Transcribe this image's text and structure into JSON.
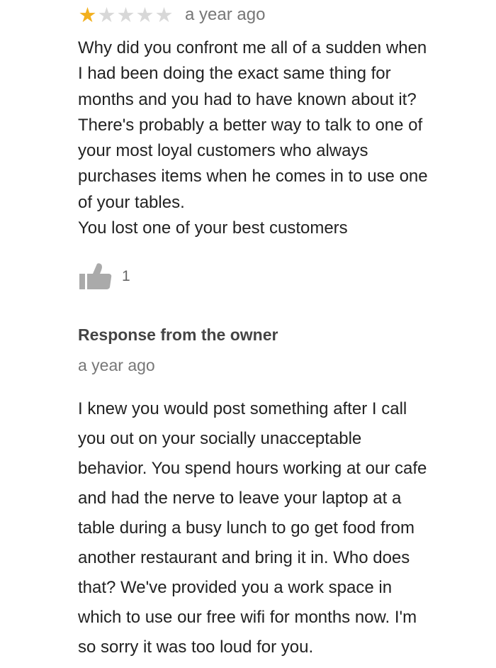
{
  "review": {
    "rating": 1,
    "rating_max": 5,
    "star_colors": {
      "filled": "#f2b01e",
      "empty": "#d8d8d8"
    },
    "timestamp": "a year ago",
    "text_lines": [
      "Why did you confront me all of a sudden when",
      "I had been doing the exact same thing for",
      "months and you had to have known about it?",
      "There's probably a better way to talk to one of",
      "your most loyal customers who always",
      "purchases items when he comes in to use one",
      "of your tables.",
      "You lost one of your best customers"
    ],
    "like_icon": "thumbs-up-icon",
    "like_count": "1"
  },
  "owner_response": {
    "heading": "Response from the owner",
    "timestamp": "a year ago",
    "text_lines": [
      "I knew you would post something after I call",
      "you out on your socially unacceptable",
      "behavior. You spend hours working at our cafe",
      "and had the nerve to leave your laptop at a",
      "table during a busy lunch to go get food from",
      "another restaurant and bring it in. Who does",
      "that? We've provided you a work space in",
      "which to use our free wifi for months now. I'm",
      "so sorry it was too loud for you."
    ]
  }
}
